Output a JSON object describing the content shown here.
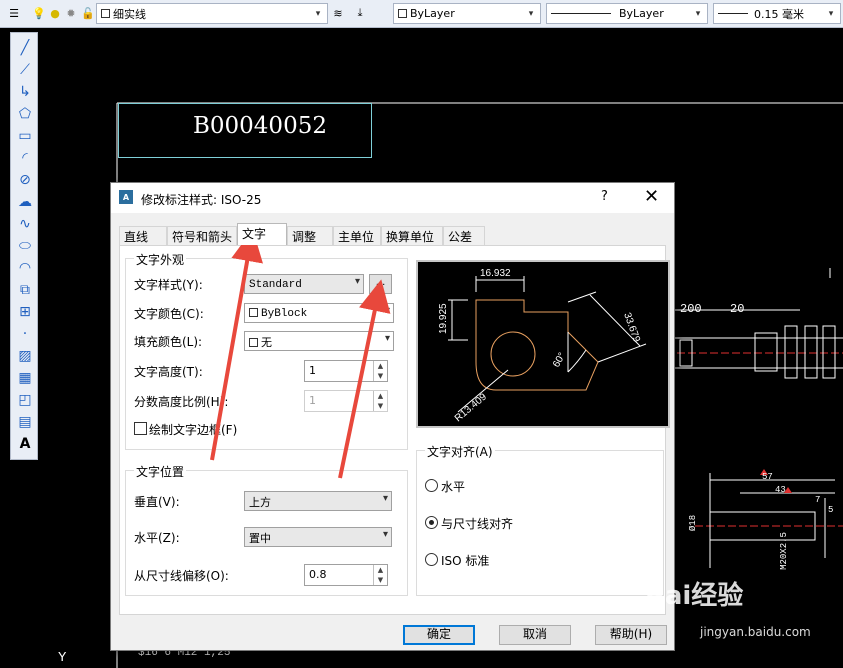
{
  "toolbar": {
    "layer_name": "细实线",
    "color_value": "ByLayer",
    "linetype_value": "ByLayer",
    "lineweight_value": "0.15 毫米"
  },
  "canvas": {
    "title_block": "B00040052",
    "dims": [
      "200",
      "20",
      "57",
      "43",
      "7",
      "5"
    ],
    "bottom_text": "$16*6 M12*1,25",
    "ucs_label": "Y",
    "left_labels": [
      "Ø18",
      "M20X2.5"
    ]
  },
  "dialog": {
    "title": "修改标注样式: ISO-25",
    "help": "?",
    "close": "✕",
    "tabs": [
      "直线",
      "符号和箭头",
      "文字",
      "调整",
      "主单位",
      "换算单位",
      "公差"
    ],
    "active_tab": 2,
    "appearance": {
      "group_title": "文字外观",
      "style_label": "文字样式(Y):",
      "style_value": "Standard",
      "style_button": "...",
      "color_label": "文字颜色(C):",
      "color_value": "ByBlock",
      "fill_label": "填充颜色(L):",
      "fill_value": "无",
      "height_label": "文字高度(T):",
      "height_value": "1",
      "fraction_label": "分数高度比例(H):",
      "fraction_value": "1",
      "frame_label": "绘制文字边框(F)"
    },
    "placement": {
      "group_title": "文字位置",
      "vertical_label": "垂直(V):",
      "vertical_value": "上方",
      "horizontal_label": "水平(Z):",
      "horizontal_value": "置中",
      "offset_label": "从尺寸线偏移(O):",
      "offset_value": "0.8"
    },
    "alignment": {
      "group_title": "文字对齐(A)",
      "options": [
        "水平",
        "与尺寸线对齐",
        "ISO 标准"
      ],
      "selected": 1
    },
    "preview": {
      "dim_top": "16.932",
      "dim_left": "19.925",
      "dim_slant": "33.679",
      "dim_angle": "60°",
      "dim_radius": "R13.409"
    },
    "buttons": {
      "ok": "确定",
      "cancel": "取消",
      "help": "帮助(H)"
    }
  },
  "watermark": {
    "brand": "Bai经验",
    "url": "jingyan.baidu.com"
  },
  "colors": {
    "arrow": "#e8483c",
    "cad_bg": "#000000",
    "preview_line": "#e8a060"
  }
}
